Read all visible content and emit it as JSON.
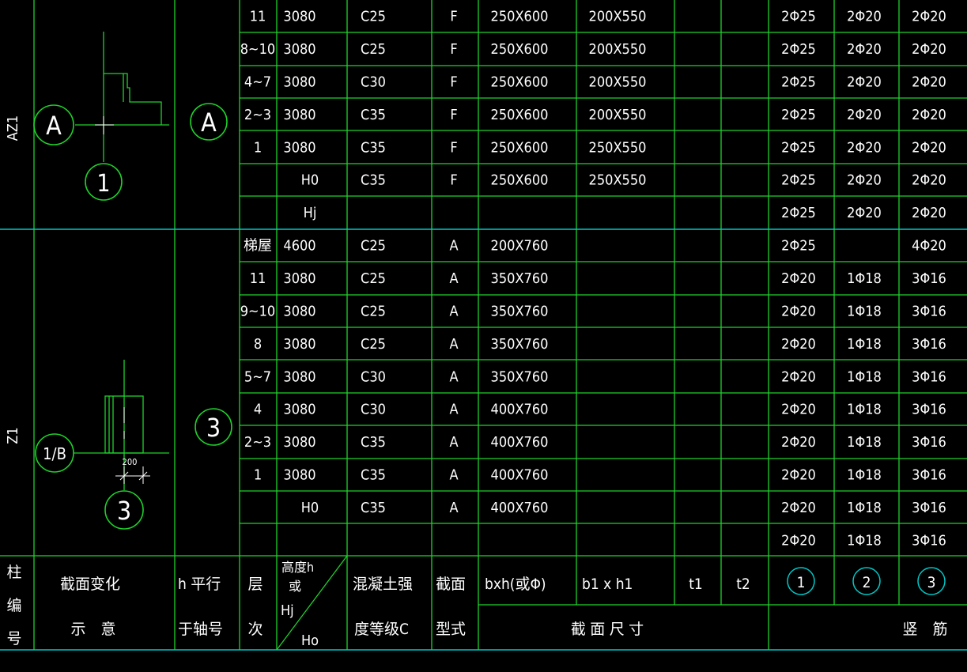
{
  "header": {
    "col_id_chars": [
      "柱",
      "编",
      "号"
    ],
    "section_change": [
      "截面变化",
      "示　意"
    ],
    "h_axis": [
      "h 平行",
      "于轴号"
    ],
    "floor": [
      "层",
      "次"
    ],
    "height": {
      "top": "高度h",
      "or": "或",
      "hj": "Hj",
      "ho": "Ho"
    },
    "concrete": [
      "混凝土强",
      "度等级C"
    ],
    "section_type": [
      "截面",
      "型式"
    ],
    "bxh": "bxh(或Φ)",
    "b1h1": "b1 x h1",
    "t1": "t1",
    "t2": "t2",
    "bar1": "1",
    "bar2": "2",
    "bar3": "3",
    "section_size": "截 面 尺 寸",
    "vertical_bars": "竖　筋"
  },
  "groups": [
    {
      "id": "AZ1",
      "axis_letter": "A",
      "axis_number": "1",
      "h_axis": "A",
      "rows": [
        {
          "floor": "11",
          "height": "3080",
          "concrete": "C25",
          "type": "F",
          "bxh": "250X600",
          "b1h1": "200X550",
          "r1": "2Φ25",
          "r2": "2Φ20",
          "r3": "2Φ20"
        },
        {
          "floor": "8~10",
          "height": "3080",
          "concrete": "C25",
          "type": "F",
          "bxh": "250X600",
          "b1h1": "200X550",
          "r1": "2Φ25",
          "r2": "2Φ20",
          "r3": "2Φ20"
        },
        {
          "floor": "4~7",
          "height": "3080",
          "concrete": "C30",
          "type": "F",
          "bxh": "250X600",
          "b1h1": "200X550",
          "r1": "2Φ25",
          "r2": "2Φ20",
          "r3": "2Φ20"
        },
        {
          "floor": "2~3",
          "height": "3080",
          "concrete": "C35",
          "type": "F",
          "bxh": "250X600",
          "b1h1": "200X550",
          "r1": "2Φ25",
          "r2": "2Φ20",
          "r3": "2Φ20"
        },
        {
          "floor": "1",
          "height": "3080",
          "concrete": "C35",
          "type": "F",
          "bxh": "250X600",
          "b1h1": "250X550",
          "r1": "2Φ25",
          "r2": "2Φ20",
          "r3": "2Φ20"
        },
        {
          "floor": "",
          "height": "H0",
          "concrete": "C35",
          "type": "F",
          "bxh": "250X600",
          "b1h1": "250X550",
          "r1": "2Φ25",
          "r2": "2Φ20",
          "r3": "2Φ20"
        },
        {
          "floor": "",
          "height": "Hj",
          "concrete": "",
          "type": "",
          "bxh": "",
          "b1h1": "",
          "r1": "2Φ25",
          "r2": "2Φ20",
          "r3": "2Φ20"
        }
      ]
    },
    {
      "id": "Z1",
      "axis_letter": "1/B",
      "axis_number": "3",
      "h_axis": "3",
      "dim": "200",
      "rows": [
        {
          "floor": "梯屋",
          "height": "4600",
          "concrete": "C25",
          "type": "A",
          "bxh": "200X760",
          "b1h1": "",
          "r1": "2Φ25",
          "r2": "",
          "r3": "4Φ20"
        },
        {
          "floor": "11",
          "height": "3080",
          "concrete": "C25",
          "type": "A",
          "bxh": "350X760",
          "b1h1": "",
          "r1": "2Φ20",
          "r2": "1Φ18",
          "r3": "3Φ16"
        },
        {
          "floor": "9~10",
          "height": "3080",
          "concrete": "C25",
          "type": "A",
          "bxh": "350X760",
          "b1h1": "",
          "r1": "2Φ20",
          "r2": "1Φ18",
          "r3": "3Φ16"
        },
        {
          "floor": "8",
          "height": "3080",
          "concrete": "C25",
          "type": "A",
          "bxh": "350X760",
          "b1h1": "",
          "r1": "2Φ20",
          "r2": "1Φ18",
          "r3": "3Φ16"
        },
        {
          "floor": "5~7",
          "height": "3080",
          "concrete": "C30",
          "type": "A",
          "bxh": "350X760",
          "b1h1": "",
          "r1": "2Φ20",
          "r2": "1Φ18",
          "r3": "3Φ16"
        },
        {
          "floor": "4",
          "height": "3080",
          "concrete": "C30",
          "type": "A",
          "bxh": "400X760",
          "b1h1": "",
          "r1": "2Φ20",
          "r2": "1Φ18",
          "r3": "3Φ16"
        },
        {
          "floor": "2~3",
          "height": "3080",
          "concrete": "C35",
          "type": "A",
          "bxh": "400X760",
          "b1h1": "",
          "r1": "2Φ20",
          "r2": "1Φ18",
          "r3": "3Φ16"
        },
        {
          "floor": "1",
          "height": "3080",
          "concrete": "C35",
          "type": "A",
          "bxh": "400X760",
          "b1h1": "",
          "r1": "2Φ20",
          "r2": "1Φ18",
          "r3": "3Φ16"
        },
        {
          "floor": "",
          "height": "H0",
          "concrete": "C35",
          "type": "A",
          "bxh": "400X760",
          "b1h1": "",
          "r1": "2Φ20",
          "r2": "1Φ18",
          "r3": "3Φ16"
        },
        {
          "floor": "",
          "height": "",
          "concrete": "",
          "type": "",
          "bxh": "",
          "b1h1": "",
          "r1": "2Φ20",
          "r2": "1Φ18",
          "r3": "3Φ16"
        }
      ]
    }
  ]
}
